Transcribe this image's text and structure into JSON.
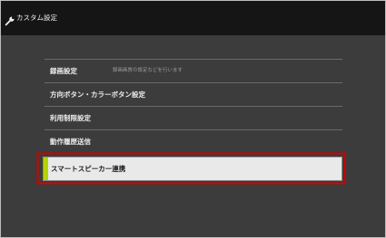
{
  "header": {
    "title": "カスタム設定",
    "icon": "wrench-icon"
  },
  "menu": {
    "items": [
      {
        "label": "録画設定",
        "description": "録画画質の設定などを行います"
      },
      {
        "label": "方向ボタン・カラーボタン設定"
      },
      {
        "label": "利用制限設定"
      },
      {
        "label": "動作履歴送信"
      }
    ],
    "selected": {
      "label": "スマートスピーカー連携"
    }
  },
  "colors": {
    "title_bar": "#151515",
    "background": "#3c3c3c",
    "selected_background": "#e9e9e9",
    "accent": "#b4d400",
    "highlight": "#d00000"
  }
}
